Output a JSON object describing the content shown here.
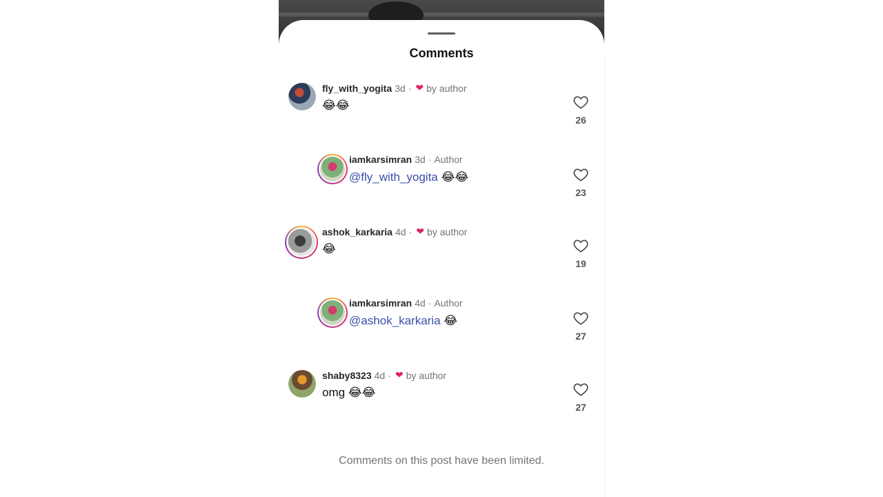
{
  "sheet": {
    "title": "Comments",
    "footer": "Comments on this post have been limited."
  },
  "comments": [
    {
      "username": "fly_with_yogita",
      "time": "3d",
      "separator": "·",
      "badge": "by author",
      "text": "😂😂",
      "mention": "",
      "likes": "26"
    },
    {
      "username": "iamkarsimran",
      "time": "3d",
      "separator": "·",
      "badge": "Author",
      "mention": "@fly_with_yogita",
      "text": " 😂😂",
      "likes": "23"
    },
    {
      "username": "ashok_karkaria",
      "time": "4d",
      "separator": "·",
      "badge": "by author",
      "text": "😂",
      "mention": "",
      "likes": "19"
    },
    {
      "username": "iamkarsimran",
      "time": "4d",
      "separator": "·",
      "badge": "Author",
      "mention": "@ashok_karkaria",
      "text": " 😂",
      "likes": "27"
    },
    {
      "username": "shaby8323",
      "time": "4d",
      "separator": "·",
      "badge": "by author",
      "text": "omg 😂😂",
      "mention": "",
      "likes": "27"
    }
  ],
  "icons": {
    "like": "heart-outline-icon",
    "liked_by_author": "heart-filled-icon"
  },
  "colors": {
    "mention": "#3a4fa8",
    "liked_heart": "#e0245e",
    "story_ring": "#c13584"
  }
}
